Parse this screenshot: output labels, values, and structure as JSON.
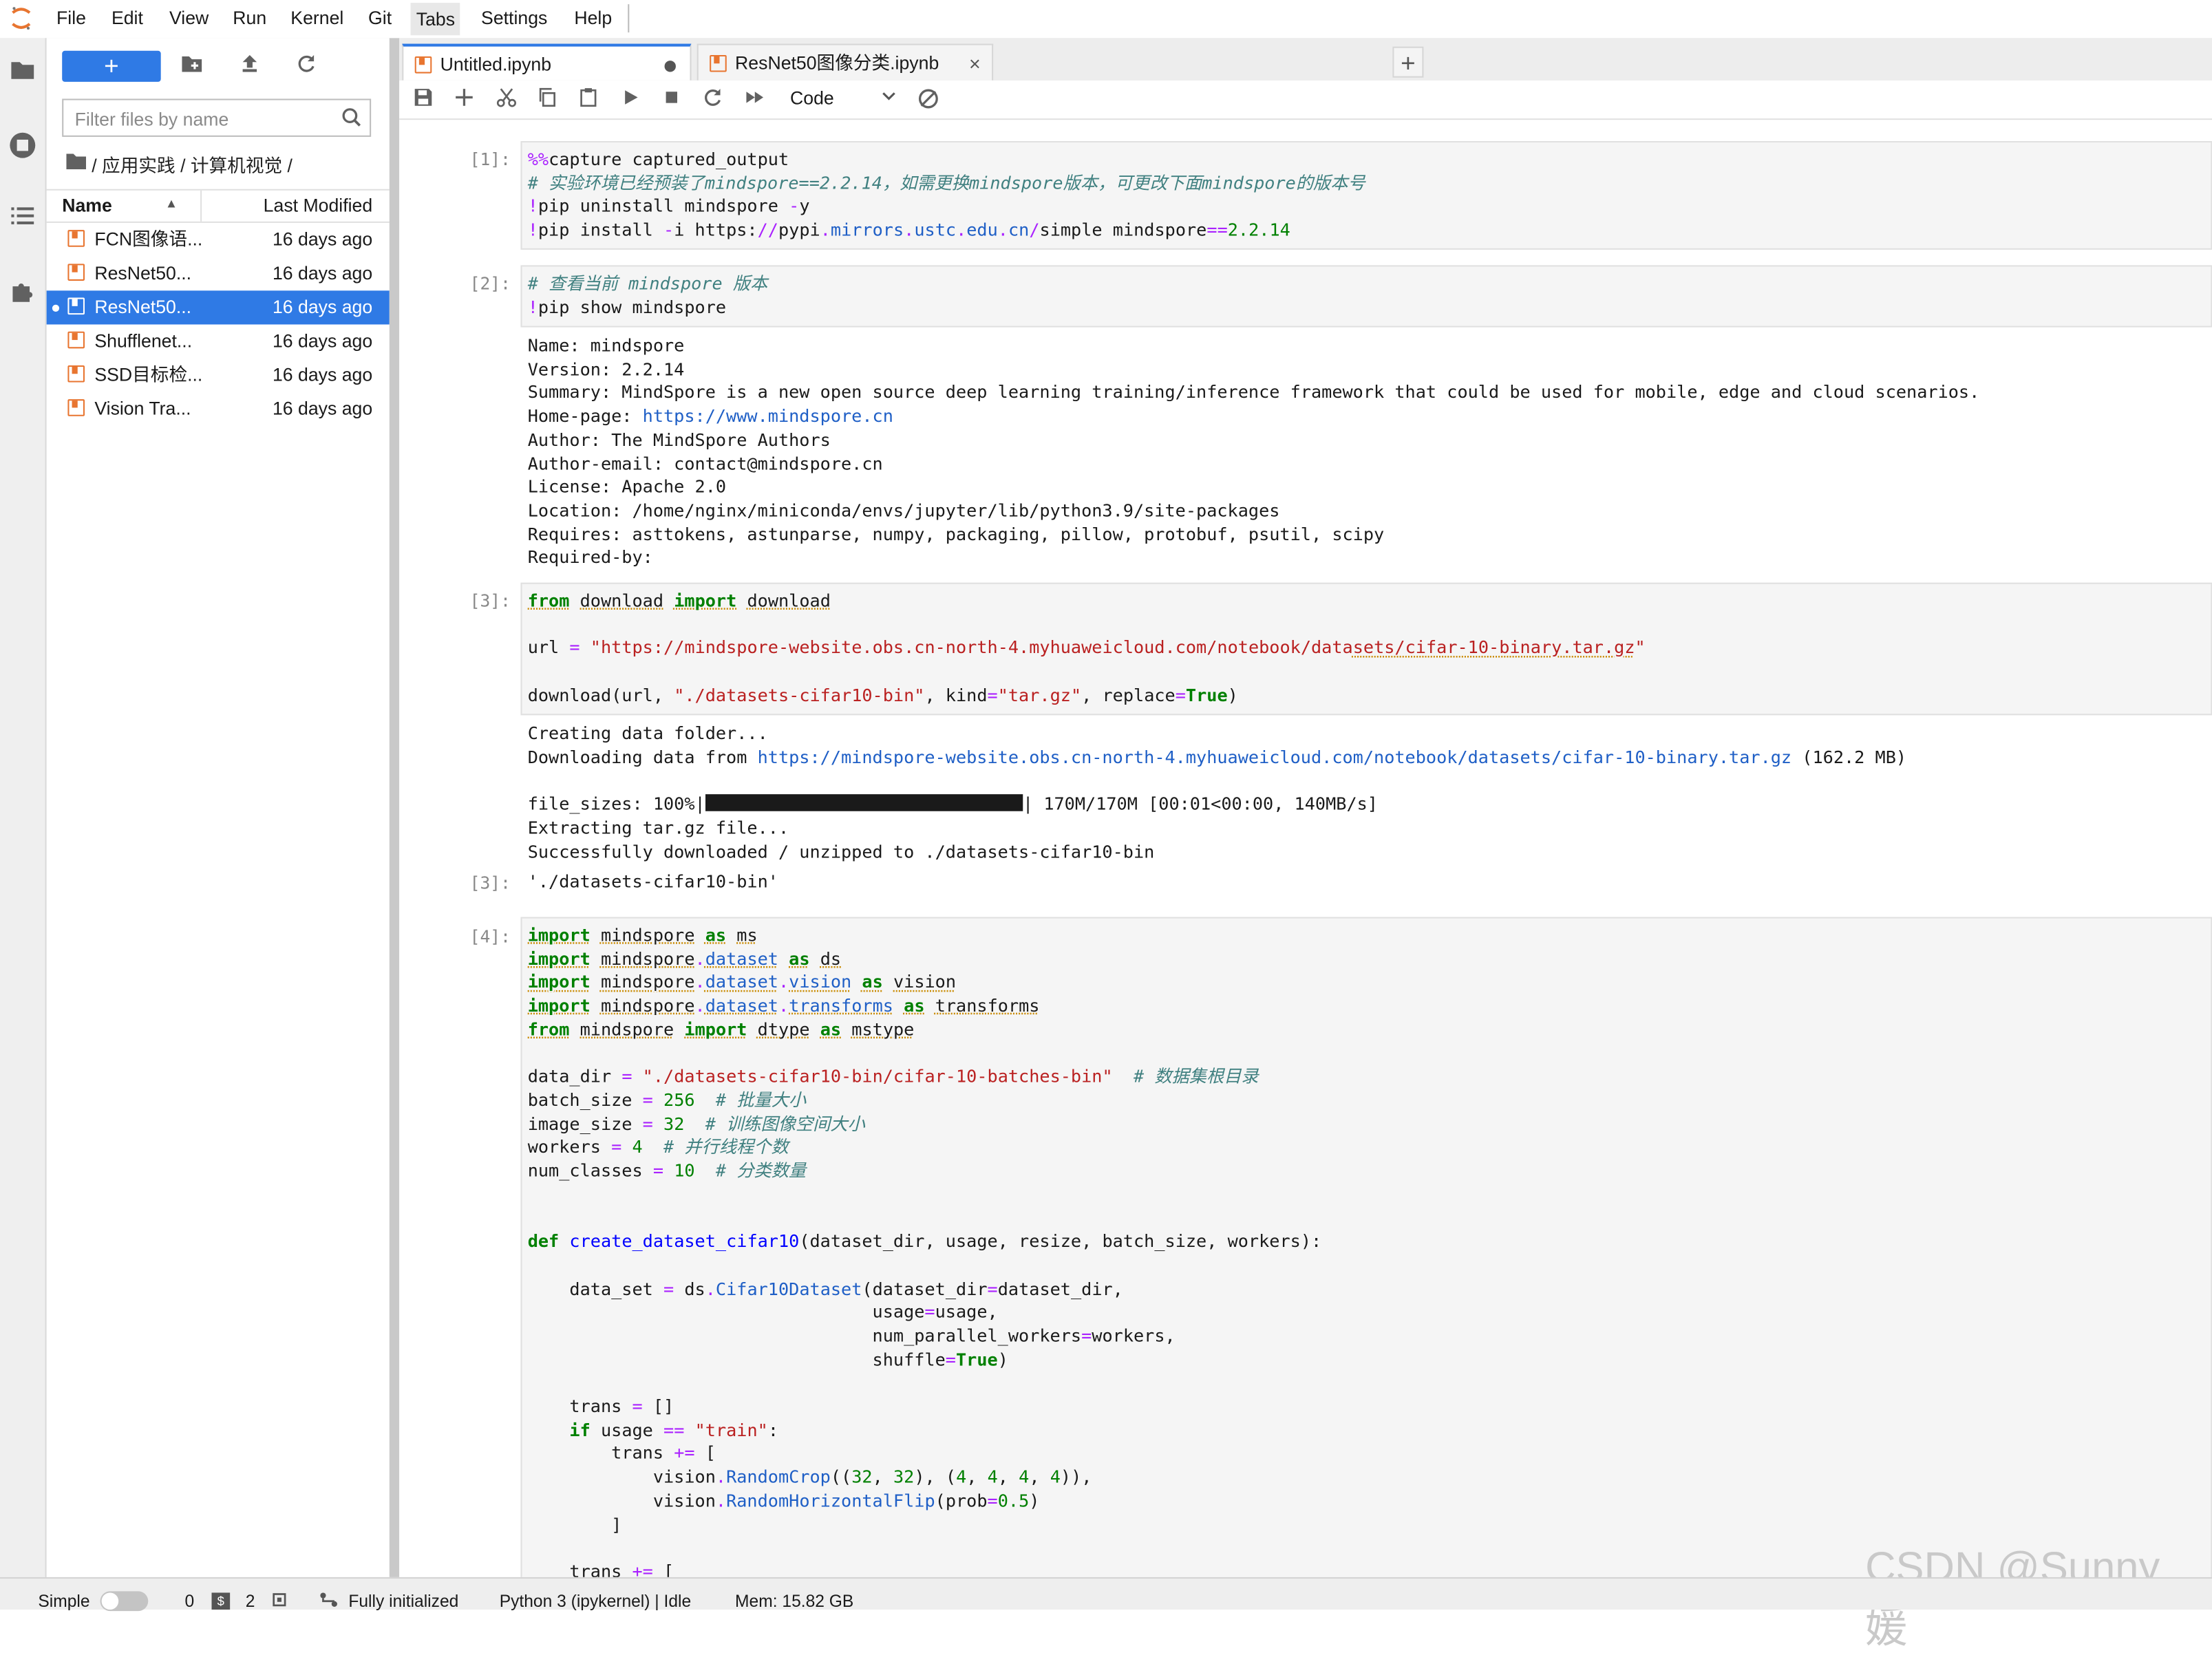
{
  "menu": [
    "File",
    "Edit",
    "View",
    "Run",
    "Kernel",
    "Git",
    "Tabs",
    "Settings",
    "Help"
  ],
  "filebrowser": {
    "new_label": "+",
    "filter_placeholder": "Filter files by name",
    "breadcrumb": "/ 应用实践 / 计算机视觉 /",
    "col_name": "Name",
    "col_modified": "Last Modified",
    "files": [
      {
        "name": "FCN图像语...",
        "modified": "16 days ago"
      },
      {
        "name": "ResNet50...",
        "modified": "16 days ago"
      },
      {
        "name": "ResNet50...",
        "modified": "16 days ago"
      },
      {
        "name": "Shufflenet...",
        "modified": "16 days ago"
      },
      {
        "name": "SSD目标检...",
        "modified": "16 days ago"
      },
      {
        "name": "Vision Tra...",
        "modified": "16 days ago"
      }
    ]
  },
  "tabs": [
    {
      "label": "Untitled.ipynb"
    },
    {
      "label": "ResNet50图像分类.ipynb",
      "close": "×"
    }
  ],
  "add_tab": "+",
  "toolbar": {
    "cell_type": "Code"
  },
  "prompts": {
    "c1": "[1]:",
    "c2": "[2]:",
    "c3": "[3]:",
    "c3out": "[3]:",
    "c4": "[4]:"
  },
  "cell2_output": [
    "Name: mindspore",
    "Version: 2.2.14",
    "Summary: MindSpore is a new open source deep learning training/inference framework that could be used for mobile, edge and cloud scenarios.",
    "Home-page: ",
    "https://www.mindspore.cn",
    "Author: The MindSpore Authors",
    "Author-email: contact@mindspore.cn",
    "License: Apache 2.0",
    "Location: /home/nginx/miniconda/envs/jupyter/lib/python3.9/site-packages",
    "Requires: asttokens, astunparse, numpy, packaging, pillow, protobuf, psutil, scipy",
    "Required-by:"
  ],
  "cell3_output": {
    "line1": "Creating data folder...",
    "line2_prefix": "Downloading data from ",
    "line2_link": "https://mindspore-website.obs.cn-north-4.myhuaweicloud.com/notebook/datasets/cifar-10-binary.tar.gz",
    "line2_suffix": " (162.2 MB)",
    "progress_prefix": "file_sizes: 100%|",
    "progress_suffix": "| 170M/170M [00:01<00:00, 140MB/s]",
    "progress_fraction": 1.0,
    "line4": "Extracting tar.gz file...",
    "line5": "Successfully downloaded / unzipped to ./datasets-cifar10-bin",
    "result": "'./datasets-cifar10-bin'"
  },
  "status": {
    "mode": "Simple",
    "terminals": "0",
    "kernels": "2",
    "init": "Fully initialized",
    "kernel": "Python 3 (ipykernel) | Idle",
    "mem": "Mem: 15.82 GB"
  },
  "watermark": "CSDN @Sunny_媛",
  "colors": {
    "accent": "#2f7ae5",
    "notebook_icon": "#e87530"
  }
}
